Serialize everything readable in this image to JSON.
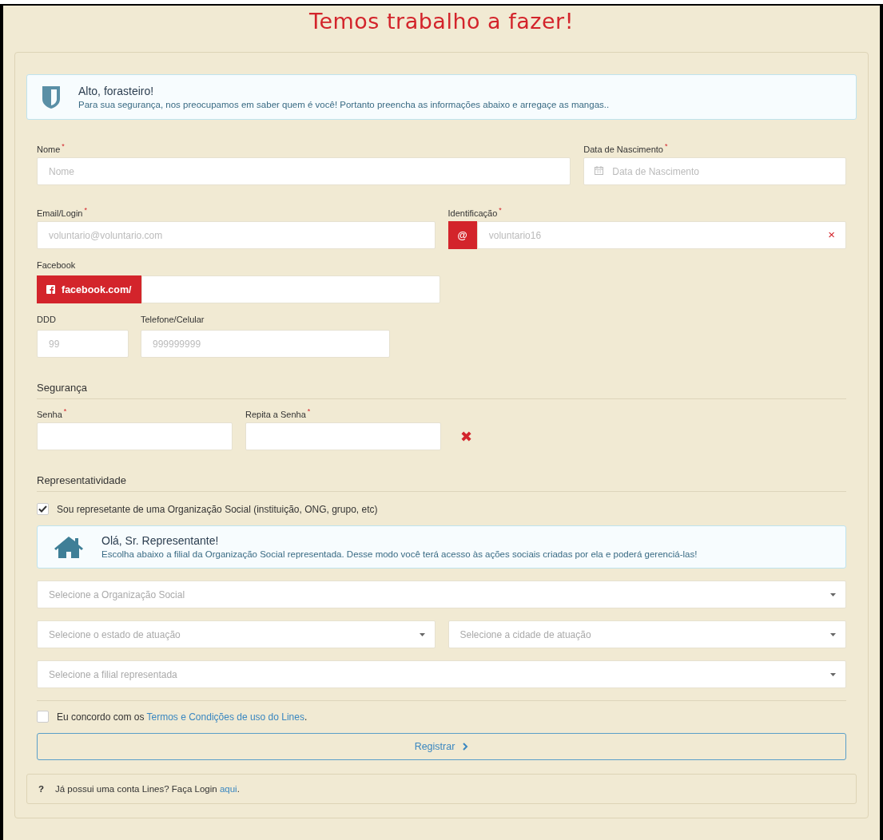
{
  "title": "Temos trabalho a fazer!",
  "intro_alert": {
    "title": "Alto, forasteiro!",
    "text": "Para sua segurança, nos preocupamos em saber quem é você! Portanto preencha as informações abaixo e arregaçe as mangas.."
  },
  "name_field": {
    "label": "Nome",
    "required_mark": "*",
    "placeholder": "Nome"
  },
  "birth_field": {
    "label": "Data de Nascimento",
    "required_mark": "*",
    "placeholder": "Data de Nascimento"
  },
  "email_field": {
    "label": "Email/Login",
    "required_mark": "*",
    "placeholder": "voluntario@voluntario.com"
  },
  "identification_field": {
    "label": "Identificação",
    "required_mark": "*",
    "prefix": "@",
    "placeholder": "voluntario16",
    "clear": "×"
  },
  "facebook_field": {
    "label": "Facebook",
    "prefix": "facebook.com/"
  },
  "ddd_field": {
    "label": "DDD",
    "placeholder": "99"
  },
  "phone_field": {
    "label": "Telefone/Celular",
    "placeholder": "999999999"
  },
  "security": {
    "heading": "Segurança",
    "password_field": {
      "label": "Senha",
      "required_mark": "*"
    },
    "repeat_field": {
      "label": "Repita a Senha",
      "required_mark": "*"
    },
    "mismatch_mark": "✖"
  },
  "representation": {
    "heading": "Representatividade",
    "representative_checkbox": {
      "label": "Sou represetante de uma Organização Social (instituição, ONG, grupo, etc)",
      "checked": true
    },
    "alert": {
      "title": "Olá, Sr. Representante!",
      "text": "Escolha abaixo a filial da Organização Social representada. Desse modo você terá acesso às ações sociais criadas por ela e poderá gerenciá-las!"
    },
    "organization_select": {
      "placeholder": "Selecione a Organização Social"
    },
    "state_select": {
      "placeholder": "Selecione o estado de atuação"
    },
    "city_select": {
      "placeholder": "Selecione a cidade de atuação"
    },
    "branch_select": {
      "placeholder": "Selecione a filial representada"
    }
  },
  "terms": {
    "checked": false,
    "text_before": "Eu concordo com os ",
    "link": "Termos e Condições de uso do Lines",
    "text_after": "."
  },
  "register_button": {
    "label": "Registrar"
  },
  "login_note": {
    "icon": "?",
    "text_before": "Já possui uma conta Lines? Faça Login ",
    "link": "aqui",
    "text_after": "."
  }
}
